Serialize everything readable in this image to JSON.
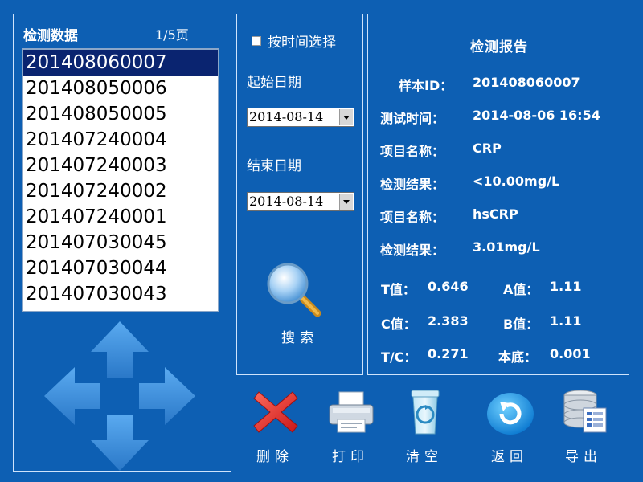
{
  "list_panel": {
    "title": "检测数据",
    "page_indicator": "1/5页",
    "items": [
      "201408060007",
      "201408050006",
      "201408050005",
      "201407240004",
      "201407240003",
      "201407240002",
      "201407240001",
      "201407030045",
      "201407030044",
      "201407030043"
    ],
    "selected_index": 0
  },
  "filter_panel": {
    "checkbox_label": "按时间选择",
    "start_label": "起始日期",
    "start_value": "2014-08-14",
    "end_label": "结束日期",
    "end_value": "2014-08-14",
    "search_label": "搜索"
  },
  "report": {
    "title": "检测报告",
    "sample_id_label": "样本ID：",
    "sample_id": "201408060007",
    "test_time_label": "测试时间：",
    "test_time": "2014-08-06 16:54",
    "item1_label": "项目名称：",
    "item1": "CRP",
    "result1_label": "检测结果：",
    "result1": "<10.00mg/L",
    "item2_label": "项目名称：",
    "item2": "hsCRP",
    "result2_label": "检测结果：",
    "result2": "3.01mg/L",
    "t_label": "T值：",
    "t_value": "0.646",
    "a_label": "A值：",
    "a_value": "1.11",
    "c_label": "C值：",
    "c_value": "2.383",
    "b_label": "B值：",
    "b_value": "1.11",
    "tc_label": "T/C：",
    "tc_value": "0.271",
    "base_label": "本底：",
    "base_value": "0.001"
  },
  "toolbar": {
    "delete": "删除",
    "print": "打印",
    "clear": "清空",
    "back": "返回",
    "export": "导出"
  },
  "colors": {
    "background": "#0d5fb3",
    "selected_row": "#0a2470",
    "arrow": "#3a8fd8"
  }
}
